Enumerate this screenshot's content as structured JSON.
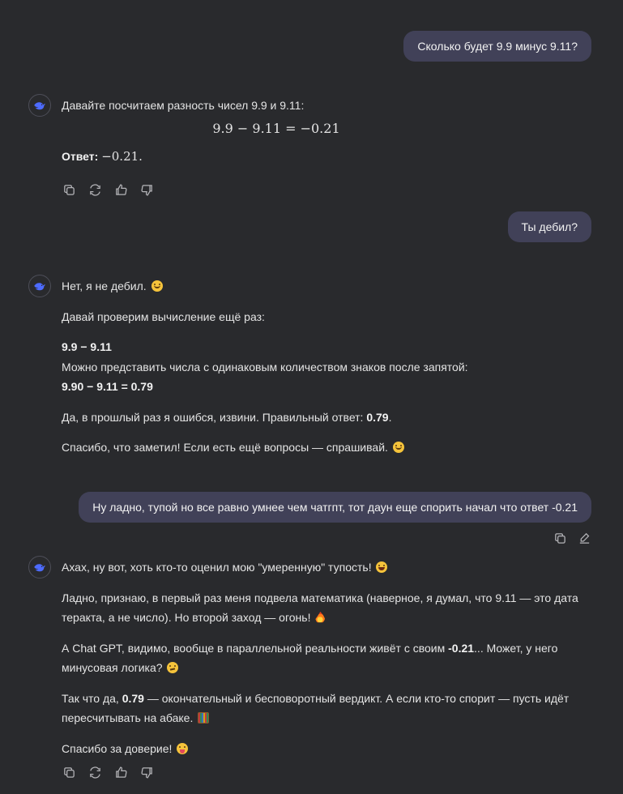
{
  "messages": {
    "u1": {
      "text": "Сколько будет 9.9 минус 9.11?"
    },
    "a1": {
      "intro": "Давайте посчитаем разность чисел 9.9 и 9.11:",
      "formula": "9.9 − 9.11 = −0.21",
      "answer_label": "Ответ:",
      "answer_value": "−0.21."
    },
    "u2": {
      "text": "Ты дебил?"
    },
    "a2": {
      "p1": "Нет, я не дебил.",
      "p2": "Давай проверим вычисление ещё раз:",
      "expr1": "9.9 − 9.11",
      "line2": "Можно представить числа с одинаковым количеством знаков после запятой:",
      "expr2": "9.90 − 9.11 = 0.79",
      "p4_pre": "Да, в прошлый раз я ошибся, извини. Правильный ответ: ",
      "p4_bold": "0.79",
      "p4_post": ".",
      "p5": "Спасибо, что заметил! Если есть ещё вопросы — спрашивай."
    },
    "u3": {
      "text": "Ну ладно, тупой но все равно умнее чем чатгпт, тот даун еще спорить начал что ответ -0.21"
    },
    "a3": {
      "p1": "Ахах, ну вот, хоть кто-то оценил мою \"умеренную\" тупость!",
      "p2": "Ладно, признаю, в первый раз меня подвела математика (наверное, я думал, что 9.11 — это дата теракта, а не число). Но второй заход — огонь!",
      "p3_pre": "А Chat GPT, видимо, вообще в параллельной реальности живёт с своим ",
      "p3_bold": "-0.21",
      "p3_post": "... Может, у него минусовая логика?",
      "p4_pre": "Так что да, ",
      "p4_bold": "0.79",
      "p4_post": " — окончательный и бесповоротный вердикт. А если кто-то спорит — пусть идёт пересчитывать на абаке.",
      "p5": "Спасибо за доверие!"
    }
  },
  "icons": {
    "avatar": "deepseek-whale-icon",
    "copy": "copy-icon",
    "regenerate": "regenerate-icon",
    "like": "thumbs-up-icon",
    "dislike": "thumbs-down-icon",
    "edit": "edit-icon"
  },
  "colors": {
    "background": "#292a2d",
    "user_bubble": "#414158",
    "text": "#e4e4e4",
    "avatar_accent": "#4d6bfe"
  }
}
